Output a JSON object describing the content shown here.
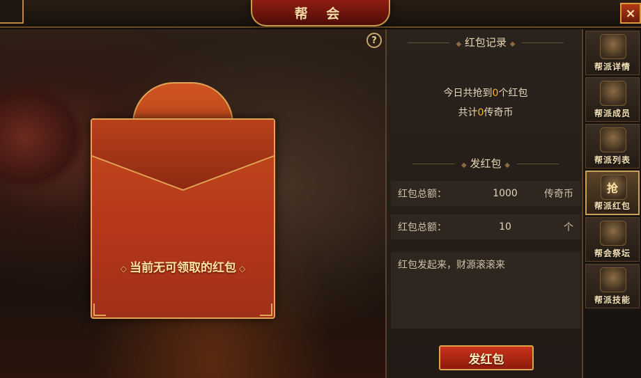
{
  "window": {
    "title": "帮 会",
    "close_glyph": "×"
  },
  "help": {
    "glyph": "?"
  },
  "envelope": {
    "message": "当前无可领取的红包",
    "deco_left": "◇",
    "deco_right": "◇"
  },
  "records": {
    "header": "红包记录",
    "line1_prefix": "今日共抢到",
    "count": "0",
    "line1_suffix": "个红包",
    "line2_prefix": "共计",
    "coins": "0",
    "line2_suffix": "传奇币"
  },
  "send": {
    "header": "发红包",
    "amount_row": {
      "label": "红包总额：",
      "value": "1000",
      "unit": "传奇币"
    },
    "count_row": {
      "label": "红包总额：",
      "value": "10",
      "unit": "个"
    },
    "message_placeholder": "红包发起来，财源滚滚来",
    "button_label": "发红包"
  },
  "sidebar": {
    "tabs": [
      {
        "label": "帮派详情",
        "icon": "book-icon",
        "active": false
      },
      {
        "label": "帮派成员",
        "icon": "warrior-helmet-icon",
        "active": false
      },
      {
        "label": "帮派列表",
        "icon": "scroll-list-icon",
        "active": false
      },
      {
        "label": "帮派红包",
        "icon": "grab-envelope-icon",
        "active": true,
        "glyph": "抢"
      },
      {
        "label": "帮会祭坛",
        "icon": "altar-icon",
        "active": false
      },
      {
        "label": "帮派技能",
        "icon": "armor-skill-icon",
        "active": false
      }
    ]
  },
  "colors": {
    "accent_gold": "#e2a455",
    "highlight": "#ffb42a",
    "envelope_red": "#b3361a"
  }
}
